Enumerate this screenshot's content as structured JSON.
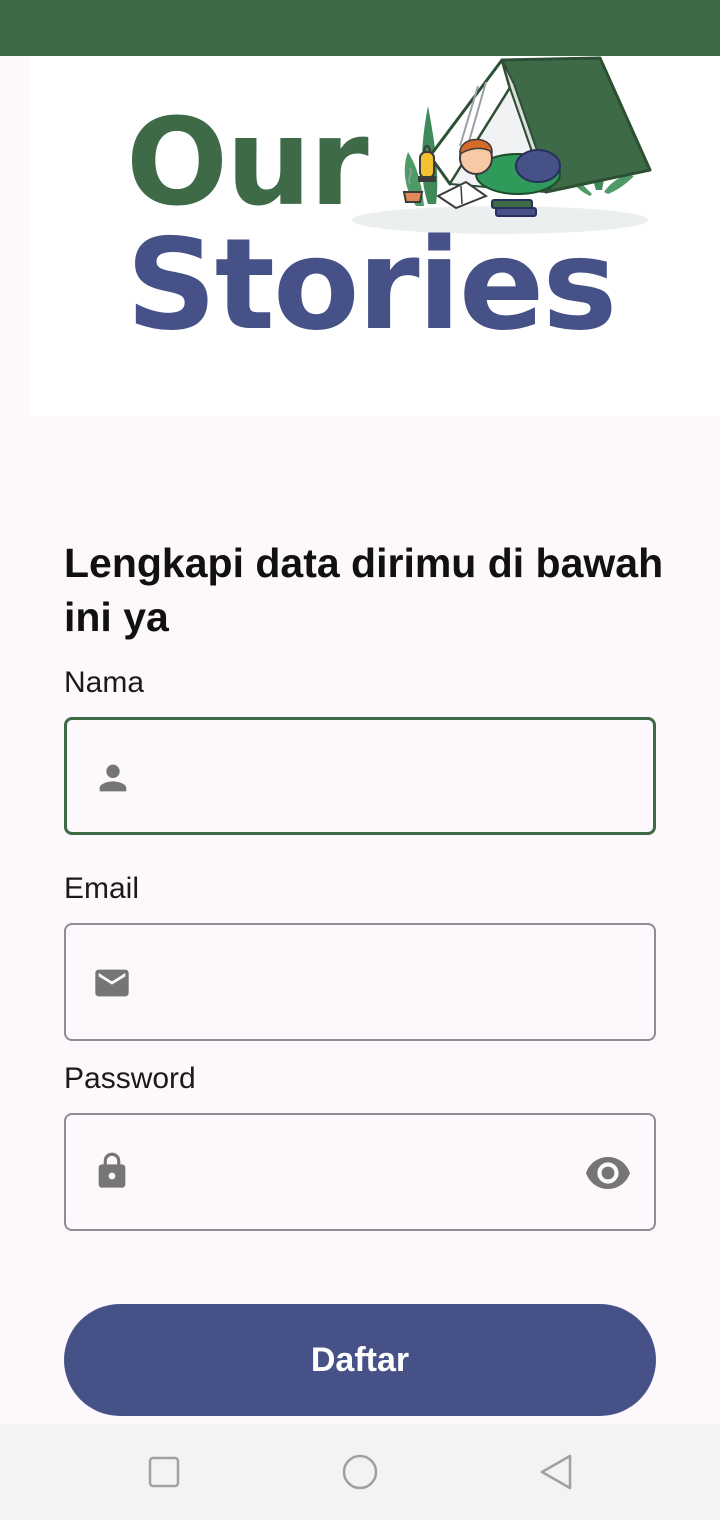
{
  "logo": {
    "line1": "Our",
    "line2": "Stories",
    "colors": {
      "line1": "#3f6a47",
      "line2": "#465287"
    }
  },
  "form": {
    "heading": "Lengkapi data dirimu di bawah ini ya",
    "fields": [
      {
        "label": "Nama",
        "icon": "person-icon",
        "value": "",
        "focused": true
      },
      {
        "label": "Email",
        "icon": "mail-icon",
        "value": ""
      },
      {
        "label": "Password",
        "icon": "lock-icon",
        "value": "",
        "trailing_icon": "eye-icon"
      }
    ],
    "submit_label": "Daftar"
  },
  "nav": {
    "buttons": [
      "recents-square-icon",
      "home-circle-icon",
      "back-triangle-icon"
    ]
  },
  "colors": {
    "accent_green": "#3f6a47",
    "accent_blue": "#465287",
    "background": "#fdf8fc"
  }
}
